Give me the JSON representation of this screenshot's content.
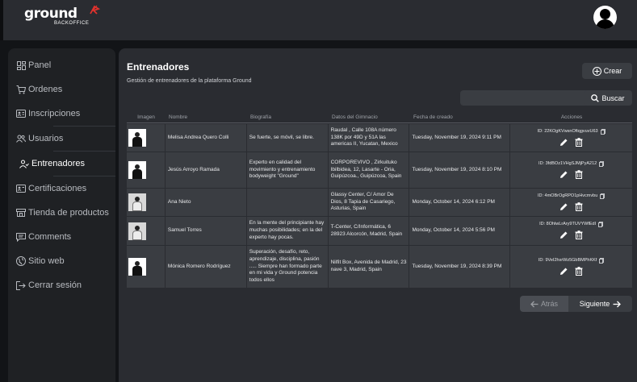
{
  "brand": {
    "name": "ground",
    "subtitle": "BACKOFFICE"
  },
  "sidebar": {
    "items": [
      {
        "label": "Panel",
        "icon": "dashboard-icon"
      },
      {
        "label": "Ordenes",
        "icon": "cart-icon"
      },
      {
        "label": "Inscripciones",
        "icon": "id-card-icon"
      },
      {
        "label": "Usuarios",
        "icon": "users-icon"
      },
      {
        "label": "Entrenadores",
        "icon": "trainer-icon"
      },
      {
        "label": "Certificaciones",
        "icon": "certificate-icon"
      },
      {
        "label": "Tienda de productos",
        "icon": "store-icon"
      },
      {
        "label": "Comments",
        "icon": "comment-icon"
      },
      {
        "label": "Sitio web",
        "icon": "globe-icon"
      },
      {
        "label": "Cerrar sesión",
        "icon": "logout-icon"
      }
    ],
    "active": "Entrenadores"
  },
  "main": {
    "title": "Entrenadores",
    "subtitle": "Gestión de entrenadores de la plataforma Ground",
    "create_label": "Crear",
    "search_placeholder": "",
    "search_label": "Buscar"
  },
  "table": {
    "headers": [
      "Imagen",
      "Nombre",
      "Biografía",
      "Datos del Gimnacio",
      "Fecha de creado",
      "Acciones"
    ],
    "rows": [
      {
        "name": "Melisa Andrea Quero Colli",
        "bio": "Se fuerte, se móvil, se libre.",
        "gym": "Raudal , Calle 108A número 138K por 49D y 51A las americas II, Yucatan, Mexico",
        "date": "Tuesday, November 19, 2024 9:11 PM",
        "id": "ID: 22KOgKVwsnOftqgvuvU63"
      },
      {
        "name": "Jesús Arroyo Ramada",
        "bio": "Experto en calidad del movimiento y entrenamiento bodyweight \"Ground\"",
        "gym": "CORPOREVIVO , Zirkuituko Ibilbidea, 12, Lasarte - Oria, Guipúzcoa., Guipúzcoa, Spain",
        "date": "Tuesday, November 19, 2024 8:10 PM",
        "id": "ID: 3fdBOz1VHgSJMjPyA212"
      },
      {
        "name": "Ana Nieto",
        "bio": "",
        "gym": "Glassy Center, C/ Amor De Dios, 8 Tapia de Casariego, Asturias, Spain",
        "date": "Monday, October 14, 2024 6:12 PM",
        "id": "ID: 4mOBrOgRPO1pHvcmvbu"
      },
      {
        "name": "Samuel Torres",
        "bio": "En la mente del principiante hay muchas posibilidades; en la del experto hay pocas.",
        "gym": "T-Center, C/Informática, 6 28923 Alcorcón, Madrid, Spain",
        "date": "Monday, October 14, 2024 5:56 PM",
        "id": "ID: 8OhlwLrAry9TUVYWfEdI"
      },
      {
        "name": "Mónica Romero Rodríguez",
        "bio": "Superación, desafío, reto, aprendizaje, disciplina, pasión ..... Siempre han formado parte en mi vida y Ground potencia todos ellos",
        "gym": "Nilfit Box, Avenida de Madrid, 23 nave 3, Madrid, Spain",
        "date": "Tuesday, November 19, 2024 8:39 PM",
        "id": "ID: 9VeI2hxrWz5GbBMPhKKf"
      }
    ]
  },
  "pagination": {
    "back_label": "Atrás",
    "next_label": "Siguiente"
  }
}
